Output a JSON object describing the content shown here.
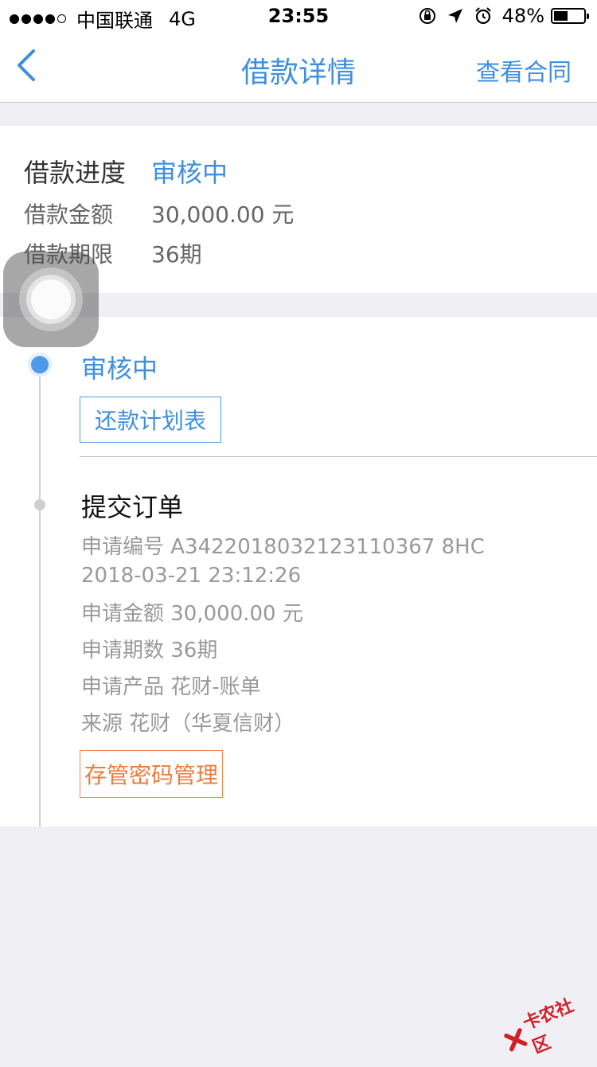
{
  "status_bar": {
    "carrier": "中国联通",
    "network": "4G",
    "time": "23:55",
    "battery": "48%",
    "battery_level": 0.48
  },
  "nav": {
    "title": "借款详情",
    "right_label": "查看合同"
  },
  "summary": {
    "progress_label": "借款进度",
    "progress_value": "审核中",
    "amount_label": "借款金额",
    "amount_value": "30,000.00 元",
    "term_label": "借款期限",
    "term_value": "36期"
  },
  "timeline": {
    "current_status": "审核中",
    "repayment_plan_button": "还款计划表",
    "submit_title": "提交订单",
    "details": [
      "申请编号 A3422018032123110367 8HC",
      "2018-03-21 23:12:26",
      "申请金额 30,000.00 元",
      "申请期数 36期",
      "申请产品 花财-账单",
      "来源 花财（华夏信财）"
    ],
    "custody_password_button": "存管密码管理"
  },
  "watermark": {
    "text": "卡农社区"
  },
  "colors": {
    "accent": "#3d8fe0",
    "orange": "#ef7b3c",
    "background": "#efeff4"
  }
}
